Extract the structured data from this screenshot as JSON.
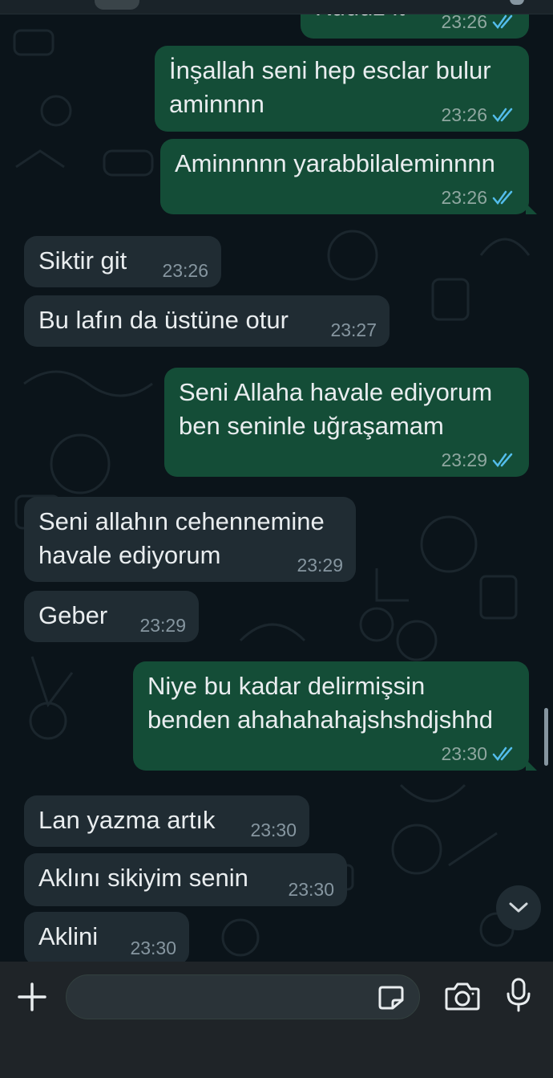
{
  "colors": {
    "background": "#0b141a",
    "outgoing_bubble": "#144d37",
    "incoming_bubble": "#202c33",
    "read_tick": "#53bdeb",
    "composer_bar": "#1f2428"
  },
  "messages": [
    {
      "direction": "out",
      "text": "Kuduz it",
      "time": "23:26",
      "status": "read"
    },
    {
      "direction": "out",
      "text": "İnşallah seni hep esclar bulur\naminnnn",
      "time": "23:26",
      "status": "read"
    },
    {
      "direction": "out",
      "text": "Aminnnnn yarabbilaleminnnn",
      "time": "23:26",
      "status": "read"
    },
    {
      "direction": "in",
      "text": "Siktir git",
      "time": "23:26"
    },
    {
      "direction": "in",
      "text": "Bu lafın da üstüne otur",
      "time": "23:27"
    },
    {
      "direction": "out",
      "text": "Seni Allaha havale ediyorum\nben seninle uğraşamam",
      "time": "23:29",
      "status": "read"
    },
    {
      "direction": "in",
      "text": "Seni allahın cehennemine\nhavale ediyorum",
      "time": "23:29"
    },
    {
      "direction": "in",
      "text": "Geber",
      "time": "23:29"
    },
    {
      "direction": "out",
      "text": "Niye bu kadar delirmişsin\nbenden ahahahahajshshdjshhd",
      "time": "23:30",
      "status": "read"
    },
    {
      "direction": "in",
      "text": "Lan yazma artık",
      "time": "23:30"
    },
    {
      "direction": "in",
      "text": "Aklını sikiyim senin",
      "time": "23:30"
    },
    {
      "direction": "in",
      "text": "Aklini",
      "time": "23:30"
    }
  ],
  "composer": {
    "input_value": "",
    "icons": [
      "plus-icon",
      "sticker-icon",
      "camera-icon",
      "microphone-icon"
    ]
  },
  "scroll_down_icon": "chevron-down-icon"
}
